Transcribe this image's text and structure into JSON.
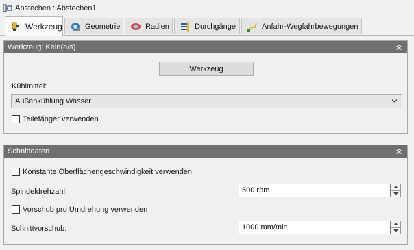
{
  "window": {
    "title": "Abstechen : Abstechen1",
    "icon": "cutoff-operation-icon"
  },
  "tabs": [
    {
      "label": "Werkzeug",
      "icon": "tool-icon",
      "active": true
    },
    {
      "label": "Geometrie",
      "icon": "geometry-icon",
      "active": false
    },
    {
      "label": "Radien",
      "icon": "radii-icon",
      "active": false
    },
    {
      "label": "Durchgänge",
      "icon": "passes-icon",
      "active": false
    },
    {
      "label": "Anfahr-Wegfahrbewegungen",
      "icon": "linking-icon",
      "active": false
    }
  ],
  "tool_section": {
    "header": "Werkzeug: Kein(e/s)",
    "tool_button": "Werkzeug",
    "coolant_label": "Kühlmittel:",
    "coolant_value": "Außenkühlung Wasser",
    "part_catcher_label": "Teilefänger verwenden",
    "part_catcher_checked": false
  },
  "cutting_section": {
    "header": "Schnittdaten",
    "css_label": "Konstante Oberflächengeschwindigkeit verwenden",
    "css_checked": false,
    "spindle_label": "Spindeldrehzahl:",
    "spindle_value": "500 rpm",
    "feed_per_rev_label": "Vorschub pro Umdrehung verwenden",
    "feed_per_rev_checked": false,
    "feedrate_label": "Schnittvorschub:",
    "feedrate_value": "1000 mm/min"
  },
  "colors": {
    "section_header": "#6f6f6f",
    "background": "#f0f0f0",
    "tool_icon_yellow": "#e8b820",
    "geometry_icon_blue": "#2f7fbf",
    "radii_icon_red": "#d84848"
  }
}
